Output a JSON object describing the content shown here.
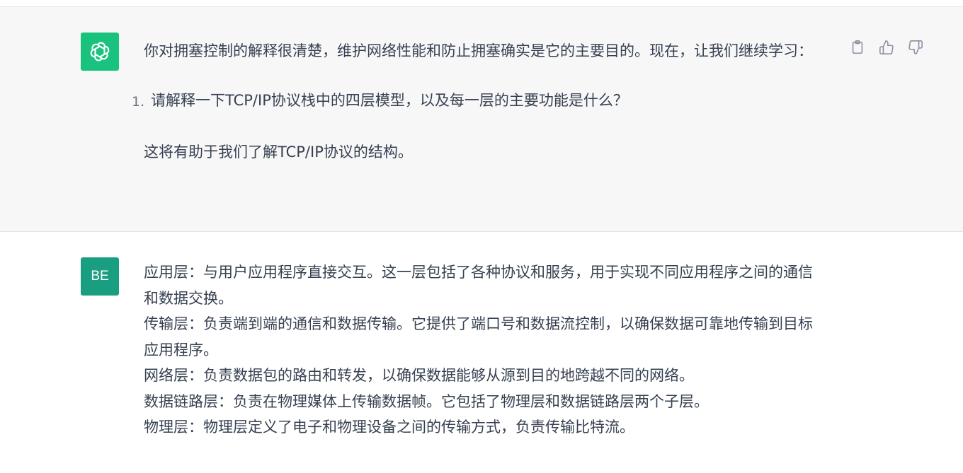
{
  "assistant_message": {
    "paragraph_1": "你对拥塞控制的解释很清楚，维护网络性能和防止拥塞确实是它的主要目的。现在，让我们继续学习：",
    "list": [
      {
        "number": "1.",
        "text": "请解释一下TCP/IP协议栈中的四层模型，以及每一层的主要功能是什么？"
      }
    ],
    "paragraph_2": "这将有助于我们了解TCP/IP协议的结构。"
  },
  "user_message": {
    "avatar_initials": "BE",
    "lines": [
      "应用层：与用户应用程序直接交互。这一层包括了各种协议和服务，用于实现不同应用程序之间的通信和数据交换。",
      "传输层：负责端到端的通信和数据传输。它提供了端口号和数据流控制，以确保数据可靠地传输到目标应用程序。",
      "网络层：负责数据包的路由和转发，以确保数据能够从源到目的地跨越不同的网络。",
      "数据链路层：负责在物理媒体上传输数据帧。它包括了物理层和数据链路层两个子层。",
      "物理层：物理层定义了电子和物理设备之间的传输方式，负责传输比特流。"
    ]
  },
  "icons": {
    "assistant_avatar": "openai-logo-icon",
    "copy": "clipboard-icon",
    "like": "thumbs-up-icon",
    "dislike": "thumbs-down-icon"
  },
  "colors": {
    "assistant_avatar_bg": "#19c37d",
    "user_avatar_bg": "#1a9e82",
    "assistant_bg": "#f7f7f8",
    "text": "#374151"
  }
}
